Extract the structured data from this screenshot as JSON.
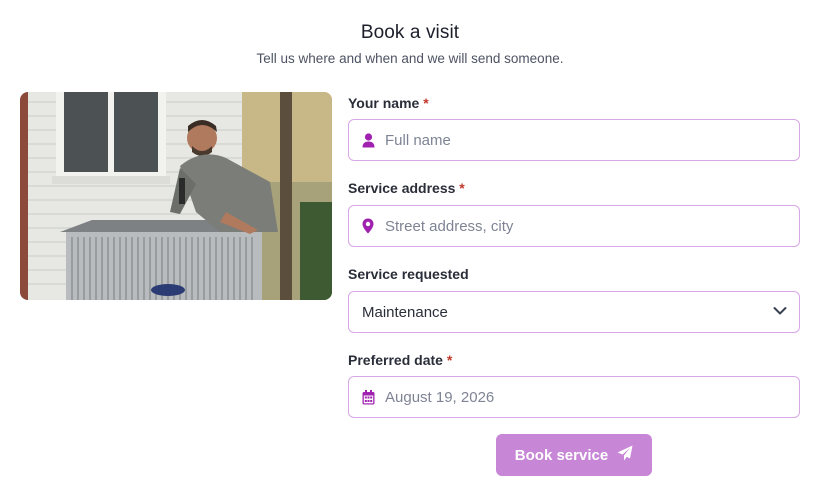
{
  "header": {
    "title": "Book a visit",
    "subtitle": "Tell us where and when and we will send someone."
  },
  "photo": {
    "alt": "Technician servicing an outdoor AC unit",
    "logo_text": "Carrier"
  },
  "form": {
    "required_mark": "*",
    "name": {
      "label": "Your name",
      "placeholder": "Full name",
      "icon": "user-icon"
    },
    "address": {
      "label": "Service address",
      "placeholder": "Street address, city",
      "icon": "map-pin-icon"
    },
    "service": {
      "label": "Service requested",
      "selected": "Maintenance",
      "icon": "chevron-down-icon"
    },
    "date": {
      "label": "Preferred date",
      "placeholder": "August 19, 2026",
      "icon": "calendar-icon"
    },
    "submit": {
      "label": "Book service",
      "icon": "paper-plane-icon"
    }
  },
  "colors": {
    "accent": "#a020b0",
    "border": "#d8a7e6",
    "button": "#c886d6",
    "required": "#c0392b"
  }
}
